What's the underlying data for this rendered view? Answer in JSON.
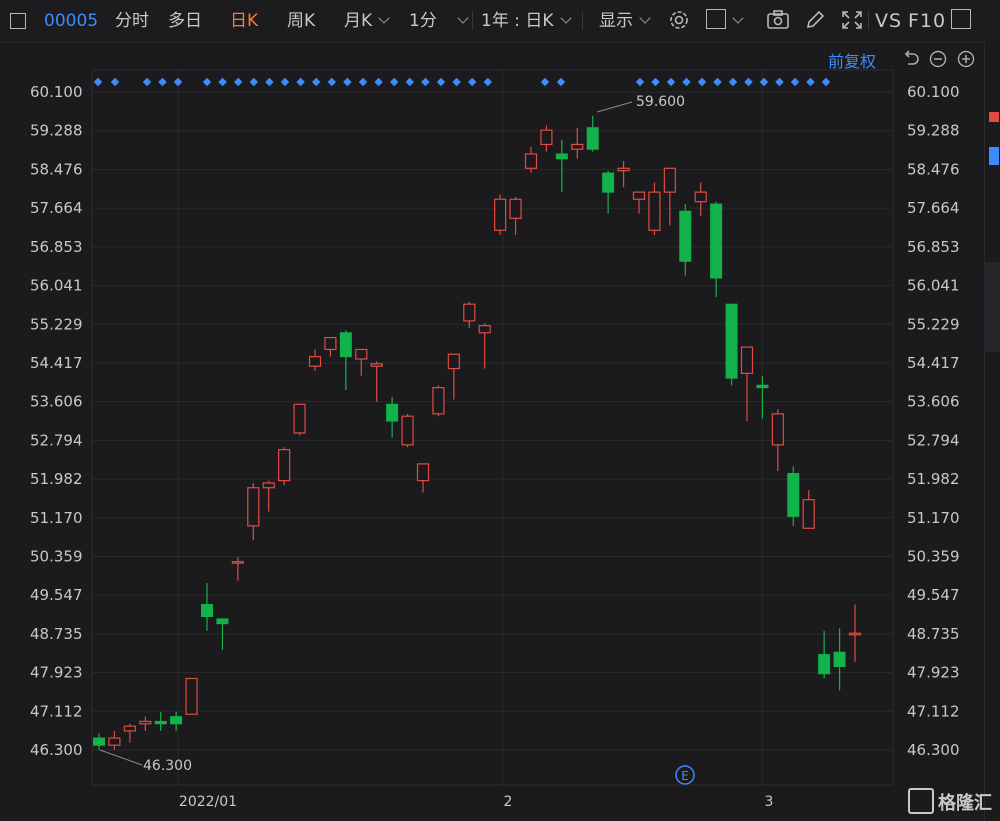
{
  "toolbar": {
    "stock_code": "00005",
    "tab_intraday": "分时",
    "tab_multiday": "多日",
    "tab_daily": "日K",
    "tab_weekly": "周K",
    "tab_monthly": "月K",
    "tab_minute": "1分",
    "range_select": "1年 : 日K",
    "display_select": "显示",
    "vs_label": "VS",
    "f10_label": "F10"
  },
  "chart_header": {
    "adjust_label": "前复权"
  },
  "watermark": {
    "text": "格隆汇"
  },
  "colors": {
    "background": "#1b1b1d",
    "up": "#e04b43",
    "down": "#13b34b",
    "accent": "#3d8bff",
    "active_tab": "#ff7a2f"
  },
  "icons": [
    "settings-icon",
    "square-icon",
    "camera-icon",
    "pen-icon",
    "expand-icon",
    "undo-icon",
    "zoom-out-icon",
    "zoom-in-icon",
    "event-icon"
  ],
  "chart_data": {
    "type": "candlestick",
    "y_ticks": [
      "60.100",
      "59.288",
      "58.476",
      "57.664",
      "56.853",
      "56.041",
      "55.229",
      "54.417",
      "53.606",
      "52.794",
      "51.982",
      "51.170",
      "50.359",
      "49.547",
      "48.735",
      "47.923",
      "47.112",
      "46.300"
    ],
    "ylim": [
      46.3,
      60.1
    ],
    "x_labels": [
      "2022/01",
      "2",
      "3"
    ],
    "annotations": {
      "high": "59.600",
      "low": "46.300"
    },
    "candles": [
      {
        "o": 46.55,
        "h": 46.65,
        "l": 46.3,
        "c": 46.4
      },
      {
        "o": 46.4,
        "h": 46.7,
        "l": 46.3,
        "c": 46.55
      },
      {
        "o": 46.7,
        "h": 46.85,
        "l": 46.45,
        "c": 46.8
      },
      {
        "o": 46.85,
        "h": 47.0,
        "l": 46.7,
        "c": 46.9
      },
      {
        "o": 46.9,
        "h": 47.1,
        "l": 46.7,
        "c": 46.85
      },
      {
        "o": 47.0,
        "h": 47.1,
        "l": 46.7,
        "c": 46.85
      },
      {
        "o": 47.05,
        "h": 47.8,
        "l": 47.05,
        "c": 47.8
      },
      {
        "o": 49.35,
        "h": 49.8,
        "l": 48.8,
        "c": 49.1
      },
      {
        "o": 49.05,
        "h": 49.05,
        "l": 48.4,
        "c": 48.95
      },
      {
        "o": 50.25,
        "h": 50.35,
        "l": 49.85,
        "c": 50.25
      },
      {
        "o": 51.0,
        "h": 51.9,
        "l": 50.7,
        "c": 51.8
      },
      {
        "o": 51.8,
        "h": 51.95,
        "l": 51.3,
        "c": 51.9
      },
      {
        "o": 51.95,
        "h": 52.65,
        "l": 51.85,
        "c": 52.6
      },
      {
        "o": 52.95,
        "h": 53.55,
        "l": 52.9,
        "c": 53.55
      },
      {
        "o": 54.35,
        "h": 54.7,
        "l": 54.25,
        "c": 54.55
      },
      {
        "o": 54.7,
        "h": 54.95,
        "l": 54.55,
        "c": 54.95
      },
      {
        "o": 55.05,
        "h": 55.1,
        "l": 53.85,
        "c": 54.55
      },
      {
        "o": 54.5,
        "h": 54.7,
        "l": 54.15,
        "c": 54.7
      },
      {
        "o": 54.35,
        "h": 54.45,
        "l": 53.6,
        "c": 54.4
      },
      {
        "o": 53.55,
        "h": 53.7,
        "l": 52.85,
        "c": 53.2
      },
      {
        "o": 52.7,
        "h": 53.35,
        "l": 52.65,
        "c": 53.3
      },
      {
        "o": 51.95,
        "h": 52.3,
        "l": 51.7,
        "c": 52.3
      },
      {
        "o": 53.35,
        "h": 53.95,
        "l": 53.3,
        "c": 53.9
      },
      {
        "o": 54.3,
        "h": 54.6,
        "l": 53.65,
        "c": 54.6
      },
      {
        "o": 55.3,
        "h": 55.7,
        "l": 55.15,
        "c": 55.65
      },
      {
        "o": 55.05,
        "h": 55.25,
        "l": 54.3,
        "c": 55.2
      },
      {
        "o": 57.2,
        "h": 57.95,
        "l": 57.1,
        "c": 57.85
      },
      {
        "o": 57.45,
        "h": 57.9,
        "l": 57.1,
        "c": 57.85
      },
      {
        "o": 58.5,
        "h": 58.95,
        "l": 58.4,
        "c": 58.8
      },
      {
        "o": 59.0,
        "h": 59.4,
        "l": 58.85,
        "c": 59.3
      },
      {
        "o": 58.8,
        "h": 59.1,
        "l": 58.0,
        "c": 58.7
      },
      {
        "o": 58.9,
        "h": 59.35,
        "l": 58.7,
        "c": 59.0
      },
      {
        "o": 59.35,
        "h": 59.6,
        "l": 58.85,
        "c": 58.9
      },
      {
        "o": 58.4,
        "h": 58.45,
        "l": 57.55,
        "c": 58.0
      },
      {
        "o": 58.45,
        "h": 58.65,
        "l": 58.1,
        "c": 58.5
      },
      {
        "o": 57.85,
        "h": 58.0,
        "l": 57.55,
        "c": 58.0
      },
      {
        "o": 57.2,
        "h": 58.2,
        "l": 57.1,
        "c": 58.0
      },
      {
        "o": 58.0,
        "h": 58.5,
        "l": 57.3,
        "c": 58.5
      },
      {
        "o": 57.6,
        "h": 57.75,
        "l": 56.25,
        "c": 56.55
      },
      {
        "o": 57.8,
        "h": 58.2,
        "l": 57.5,
        "c": 58.0
      },
      {
        "o": 57.75,
        "h": 57.8,
        "l": 55.8,
        "c": 56.2
      },
      {
        "o": 55.65,
        "h": 55.65,
        "l": 53.95,
        "c": 54.1
      },
      {
        "o": 54.2,
        "h": 54.75,
        "l": 53.2,
        "c": 54.75
      },
      {
        "o": 53.95,
        "h": 54.15,
        "l": 53.25,
        "c": 53.9
      },
      {
        "o": 52.7,
        "h": 53.45,
        "l": 52.15,
        "c": 53.35
      },
      {
        "o": 52.1,
        "h": 52.25,
        "l": 51.0,
        "c": 51.2
      },
      {
        "o": 50.95,
        "h": 51.75,
        "l": 50.95,
        "c": 51.55
      },
      {
        "o": 48.3,
        "h": 48.8,
        "l": 47.8,
        "c": 47.9
      },
      {
        "o": 48.35,
        "h": 48.85,
        "l": 47.55,
        "c": 48.05
      },
      {
        "o": 48.75,
        "h": 49.35,
        "l": 48.15,
        "c": 48.75
      }
    ]
  }
}
